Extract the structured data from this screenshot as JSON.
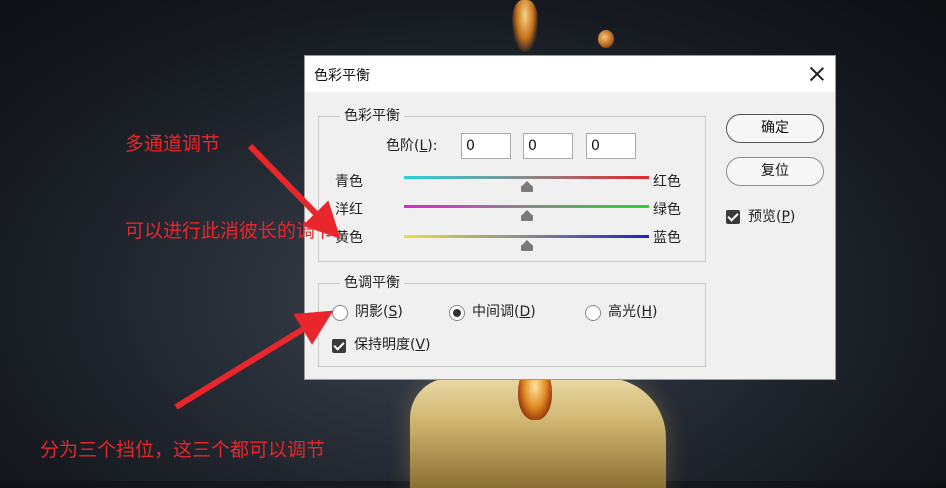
{
  "dialog": {
    "title": "色彩平衡",
    "color_balance_group": {
      "legend": "色彩平衡",
      "levels_label": "色阶",
      "levels_key": "(L)",
      "levels_key_letter": "L",
      "levels_values": [
        "0",
        "0",
        "0"
      ],
      "sliders": [
        {
          "left": "青色",
          "right": "红色",
          "value": 0
        },
        {
          "left": "洋红",
          "right": "绿色",
          "value": 0
        },
        {
          "left": "黄色",
          "right": "蓝色",
          "value": 0
        }
      ]
    },
    "tone_balance_group": {
      "legend": "色调平衡",
      "options": [
        {
          "label": "阴影",
          "key": "S",
          "selected": false
        },
        {
          "label": "中间调",
          "key": "D",
          "selected": true
        },
        {
          "label": "高光",
          "key": "H",
          "selected": false
        }
      ],
      "preserve_luminosity": {
        "label": "保持明度",
        "key": "V",
        "checked": true
      }
    },
    "buttons": {
      "ok": "确定",
      "reset": "复位"
    },
    "preview": {
      "label": "预览",
      "key": "P",
      "checked": true
    }
  },
  "annotations": {
    "multi_channel": "多通道调节",
    "mutual": "可以进行此消彼长的调节",
    "three_positions": "分为三个挡位，这三个都可以调节"
  },
  "colors": {
    "annotation_red": "#e8262c",
    "slider_cyan_red": [
      "#27d3d6",
      "#e0262b"
    ],
    "slider_magenta_green": [
      "#e022d4",
      "#27d62a"
    ],
    "slider_yellow_blue": [
      "#e8e23a",
      "#1a1fd0"
    ]
  },
  "icons": [
    "close-icon",
    "slider-thumb-icon",
    "radio-icon",
    "checkbox-icon",
    "arrow-icon"
  ]
}
